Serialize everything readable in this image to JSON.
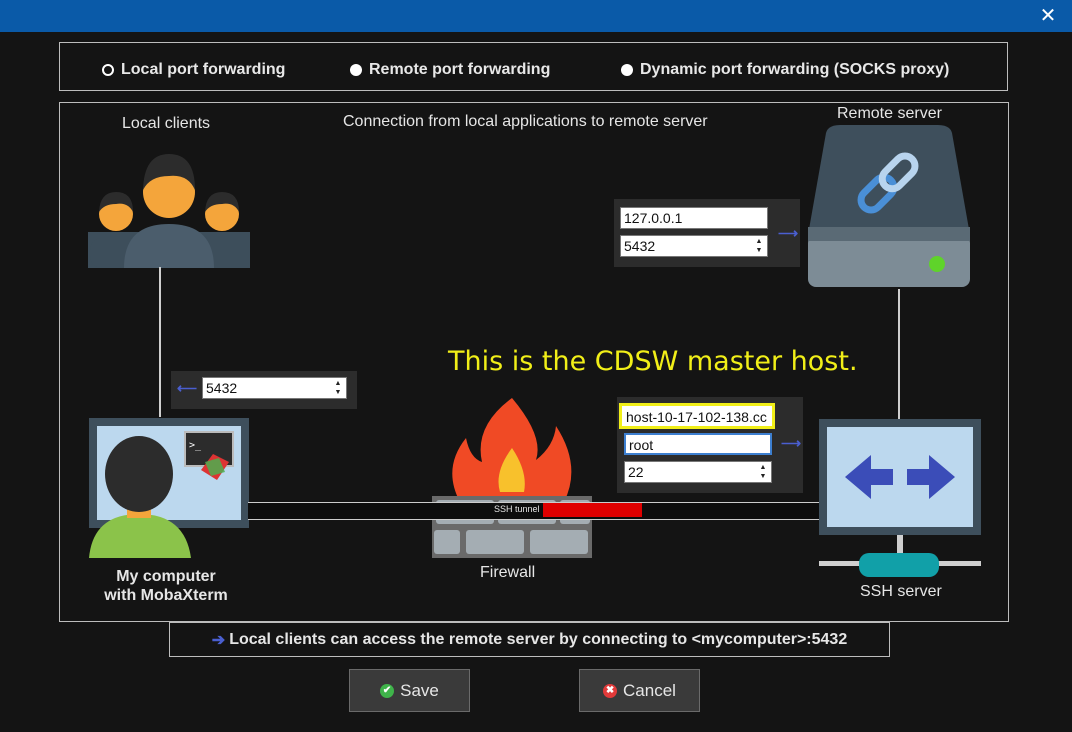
{
  "window": {
    "close_icon": "close-icon"
  },
  "modes": [
    {
      "label": "Local port forwarding",
      "selected": true
    },
    {
      "label": "Remote port forwarding",
      "selected": false
    },
    {
      "label": "Dynamic port forwarding (SOCKS proxy)",
      "selected": false
    }
  ],
  "diagram": {
    "local_clients_label": "Local clients",
    "connection_text": "Connection from local applications to remote server",
    "remote_server_label": "Remote server",
    "my_computer_line1": "My computer",
    "my_computer_line2": "with MobaXterm",
    "firewall_label": "Firewall",
    "ssh_server_label": "SSH server",
    "ssh_tunnel_label": "SSH tunnel",
    "annotation": "This is the CDSW master host."
  },
  "remote": {
    "host": "127.0.0.1",
    "port": "5432"
  },
  "local": {
    "port": "5432"
  },
  "ssh": {
    "host": "host-10-17-102-138.cc",
    "user": "root",
    "port": "22"
  },
  "info": {
    "text": "Local clients can access the remote server by connecting to <mycomputer>:5432"
  },
  "buttons": {
    "save": "Save",
    "cancel": "Cancel"
  },
  "colors": {
    "titlebar": "#0a5aa8",
    "highlight": "#f1ef18",
    "accent_arrow": "#4a5fd0",
    "tunnel_bar": "#e00000"
  }
}
